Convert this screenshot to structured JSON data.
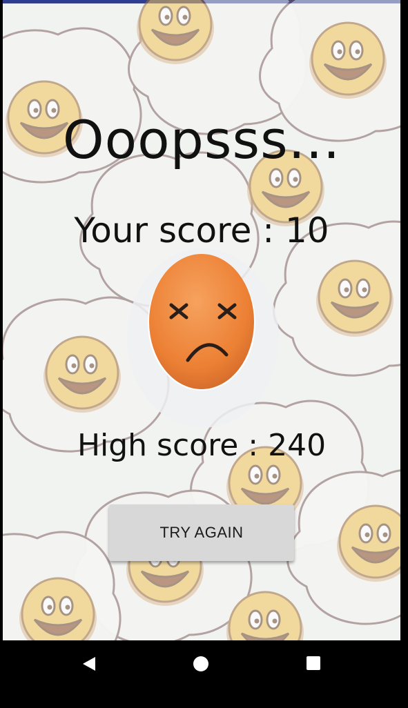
{
  "game_over": {
    "title": "Ooopsss...",
    "score_text": "Your score : 10",
    "high_score_text": "High score : 240",
    "try_again_label": "TRY AGAIN"
  },
  "icons": {
    "mascot": "sad-egg-icon",
    "nav_back": "back-triangle-icon",
    "nav_home": "home-circle-icon",
    "nav_recents": "recents-square-icon"
  },
  "colors": {
    "status_strip": "#2f3e8f",
    "button_bg": "#d8d8d8",
    "egg": "#f08a3a"
  }
}
